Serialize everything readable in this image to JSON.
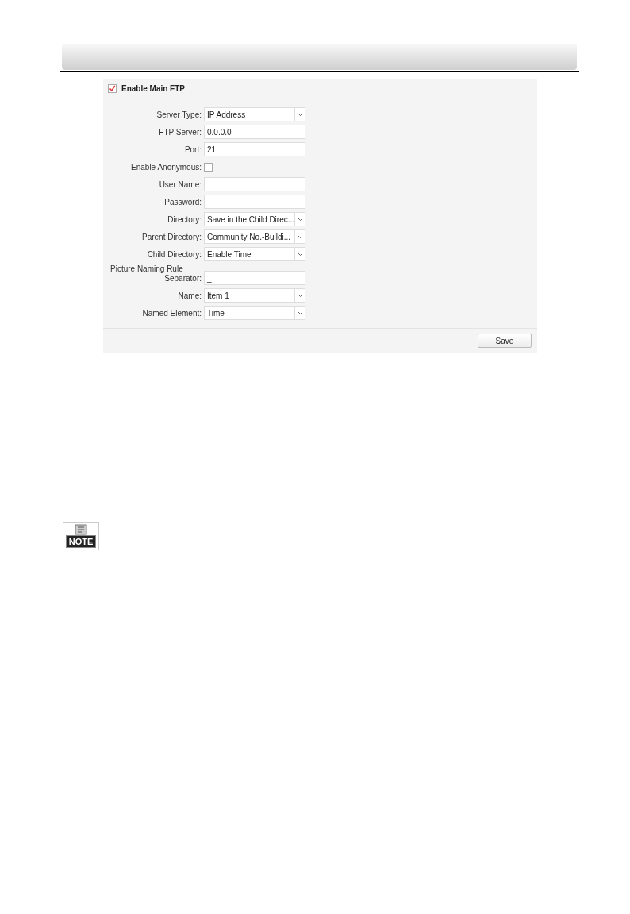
{
  "ftp_panel": {
    "enable_main_ftp": {
      "label": "Enable Main FTP",
      "checked": true
    },
    "fields": [
      {
        "kind": "select",
        "label": "Server Type:",
        "value": "IP Address"
      },
      {
        "kind": "text",
        "label": "FTP Server:",
        "value": "0.0.0.0"
      },
      {
        "kind": "text",
        "label": "Port:",
        "value": "21"
      },
      {
        "kind": "checkbox",
        "label": "Enable Anonymous:",
        "checked": false
      },
      {
        "kind": "text",
        "label": "User Name:"
      },
      {
        "kind": "text",
        "label": "Password:"
      },
      {
        "kind": "select",
        "label": "Directory:",
        "value": "Save in the Child Direc..."
      },
      {
        "kind": "select",
        "label": "Parent Directory:",
        "value": "Community No.-Buildi..."
      },
      {
        "kind": "select",
        "label": "Child Directory:",
        "value": "Enable Time"
      },
      {
        "kind": "heading",
        "label": "Picture Naming Rule"
      },
      {
        "kind": "text",
        "label": "Separator:",
        "value": "_"
      },
      {
        "kind": "select",
        "label": "Name:",
        "value": "Item 1"
      },
      {
        "kind": "select",
        "label": "Named Element:",
        "value": "Time"
      }
    ],
    "buttons": [
      "Save"
    ]
  },
  "note_badge": "NOTE"
}
